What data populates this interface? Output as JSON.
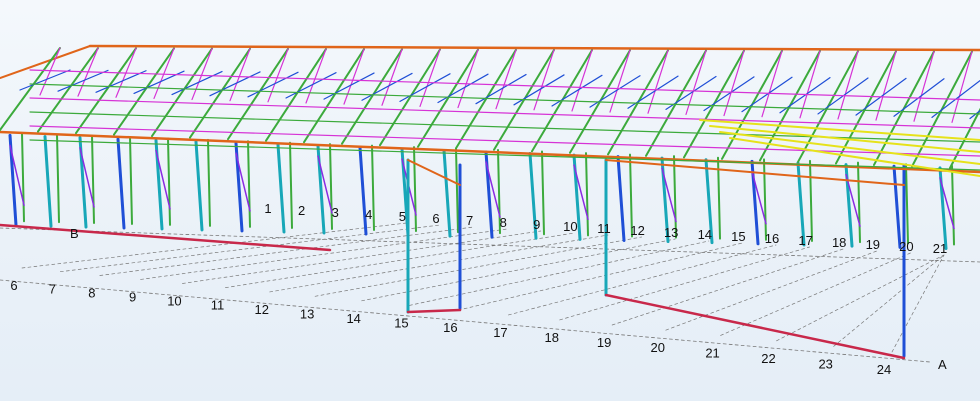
{
  "model_view": {
    "front_grid_labels": [
      "6",
      "7",
      "8",
      "9",
      "10",
      "11",
      "12",
      "13",
      "14",
      "15",
      "16",
      "17",
      "18",
      "19",
      "20",
      "21",
      "22",
      "23",
      "24"
    ],
    "back_grid_labels": [
      "1",
      "2",
      "3",
      "4",
      "5",
      "6",
      "7",
      "8",
      "9",
      "10",
      "11",
      "12",
      "13",
      "14",
      "15",
      "16",
      "17",
      "18",
      "19",
      "20",
      "21"
    ],
    "row_labels": {
      "back": "B",
      "front": "A"
    },
    "colors": {
      "background": "#eef4fa",
      "columns_blue": "#1f4fd6",
      "columns_cyan": "#18a7b8",
      "trusses_green": "#3caa3c",
      "bracing_magenta": "#d633d6",
      "bracing_purple": "#8a2be2",
      "beams_orange": "#e0651a",
      "base_beams_red": "#c8284a",
      "purlins_yellow": "#e6e21a",
      "grid_lines": "#777777"
    }
  }
}
